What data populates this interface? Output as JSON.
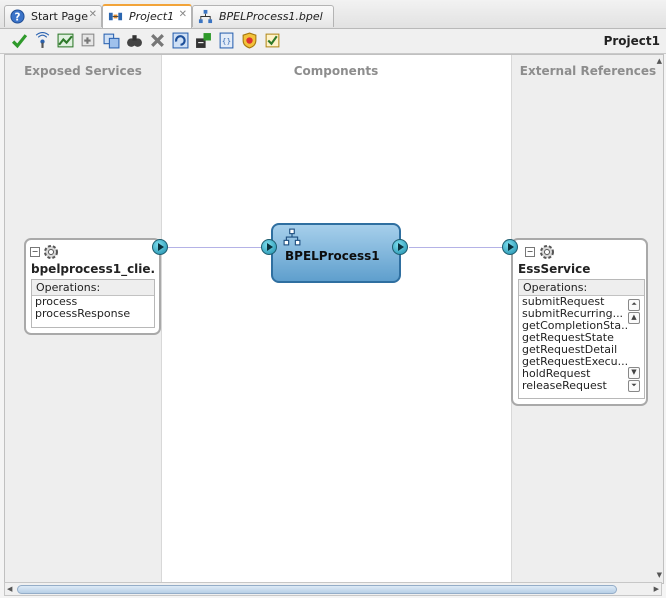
{
  "tabs": [
    {
      "label": "Start Page",
      "icon": "help-icon"
    },
    {
      "label": "Project1",
      "icon": "composite-icon"
    },
    {
      "label": "BPELProcess1.bpel",
      "icon": "bpel-icon"
    }
  ],
  "toolbar": {
    "icons": [
      "validate-icon",
      "wireless-icon",
      "chart-icon",
      "add-icon",
      "copy-icon",
      "find-icon",
      "delete-icon",
      "refresh-icon",
      "deploy-icon",
      "xml-icon",
      "policy-icon",
      "task-icon"
    ],
    "project_title": "Project1"
  },
  "canvas": {
    "columns": {
      "exposed": "Exposed Services",
      "components": "Components",
      "external": "External References"
    }
  },
  "exposed_service": {
    "name": "bpelprocess1_clie...",
    "ops_header": "Operations:",
    "operations": [
      "process",
      "processResponse"
    ]
  },
  "component": {
    "name": "BPELProcess1"
  },
  "external_reference": {
    "name": "EssService",
    "ops_header": "Operations:",
    "operations": [
      "submitRequest",
      "submitRecurring...",
      "getCompletionSta...",
      "getRequestState",
      "getRequestDetail",
      "getRequestExecu...",
      "holdRequest",
      "releaseRequest"
    ]
  },
  "colors": {
    "accent": "#f2a43a",
    "component_fill": "#6fa9d3",
    "wire": "#b4b2e6",
    "arrow": "#1b8aa8"
  }
}
